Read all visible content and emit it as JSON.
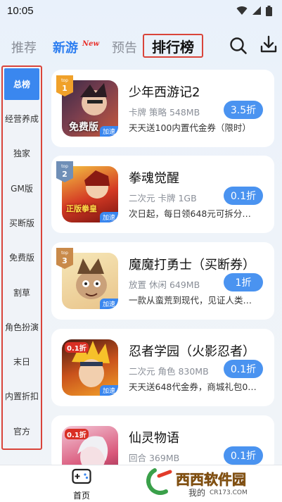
{
  "status_bar": {
    "time": "10:05"
  },
  "top_nav": {
    "tabs": [
      {
        "label": "推荐"
      },
      {
        "label": "新游",
        "badge": "New"
      },
      {
        "label": "预告"
      },
      {
        "label": "排行榜",
        "active": true
      }
    ]
  },
  "sidebar": {
    "items": [
      {
        "label": "总榜",
        "active": true
      },
      {
        "label": "经营养成"
      },
      {
        "label": "独家"
      },
      {
        "label": "GM版"
      },
      {
        "label": "买断版"
      },
      {
        "label": "免费版"
      },
      {
        "label": "割草"
      },
      {
        "label": "角色扮演"
      },
      {
        "label": "末日"
      },
      {
        "label": "内置折扣"
      },
      {
        "label": "官方"
      }
    ]
  },
  "games": [
    {
      "rank": "1",
      "rank_tag": "top",
      "title": "少年西游记2",
      "meta": "卡牌 策略 548MB",
      "desc": "天天送100内置代金券（限时）",
      "discount": "3.5折",
      "cover_text": "免费版",
      "speed_tag": "加速"
    },
    {
      "rank": "2",
      "rank_tag": "top",
      "title": "拳魂觉醒",
      "meta": "二次元 卡牌 1GB",
      "desc": "次日起，每日领648元可拆分…",
      "discount": "0.1折",
      "cover_text": "正版拳皇",
      "speed_tag": "加速"
    },
    {
      "rank": "3",
      "rank_tag": "top",
      "title": "魔魔打勇士（买断券）",
      "meta": "放置 休闲 649MB",
      "desc": "一款从蛮荒到现代，见证人类…",
      "discount": "1折",
      "cover_text": "",
      "speed_tag": "加速"
    },
    {
      "rank": "",
      "title": "忍者学园（火影忍者）",
      "meta": "二次元 角色 830MB",
      "desc": "天天送648代金券，商城礼包0…",
      "discount": "0.1折",
      "cover_text": "0.1折",
      "speed_tag": "加速"
    },
    {
      "rank": "",
      "title": "仙灵物语",
      "meta": "回合 369MB",
      "desc": "",
      "discount": "0.1折",
      "cover_text": "0.1折",
      "speed_tag": ""
    }
  ],
  "bottom_nav": {
    "home_label": "首页",
    "mine_label": "我的"
  },
  "watermark": {
    "brand": "西西软件园",
    "site": "CR173.COM"
  },
  "colors": {
    "accent": "#3a87ef",
    "highlight_border": "#d9443a",
    "new_badge": "#e8302a"
  }
}
